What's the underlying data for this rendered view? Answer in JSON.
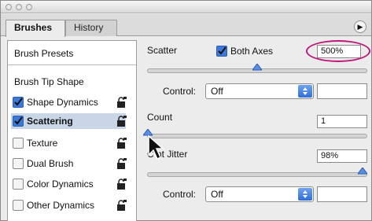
{
  "tabs": [
    {
      "label": "Brushes",
      "active": true
    },
    {
      "label": "History",
      "active": false
    }
  ],
  "sidebar": {
    "header": "Brush Presets",
    "items": [
      {
        "label": "Brush Tip Shape",
        "checkbox": false,
        "checked": false,
        "lock": false
      },
      {
        "label": "Shape Dynamics",
        "checkbox": true,
        "checked": true,
        "lock": true
      },
      {
        "label": "Scattering",
        "checkbox": true,
        "checked": true,
        "lock": true,
        "selected": true
      },
      {
        "label": "Texture",
        "checkbox": true,
        "checked": false,
        "lock": true
      },
      {
        "label": "Dual Brush",
        "checkbox": true,
        "checked": false,
        "lock": true
      },
      {
        "label": "Color Dynamics",
        "checkbox": true,
        "checked": false,
        "lock": true
      },
      {
        "label": "Other Dynamics",
        "checkbox": true,
        "checked": false,
        "lock": true
      }
    ]
  },
  "scatter": {
    "label": "Scatter",
    "both_axes_label": "Both Axes",
    "both_axes_checked": true,
    "value": "500%",
    "control_label": "Control:",
    "control_value": "Off"
  },
  "count": {
    "label": "Count",
    "value": "1"
  },
  "count_jitter": {
    "label": "Count Jitter",
    "visible_label": "C   nt Jitter",
    "value": "98%",
    "control_label": "Control:",
    "control_value": "Off"
  },
  "colors": {
    "highlight": "#c0177b",
    "accent": "#3b78d8"
  }
}
